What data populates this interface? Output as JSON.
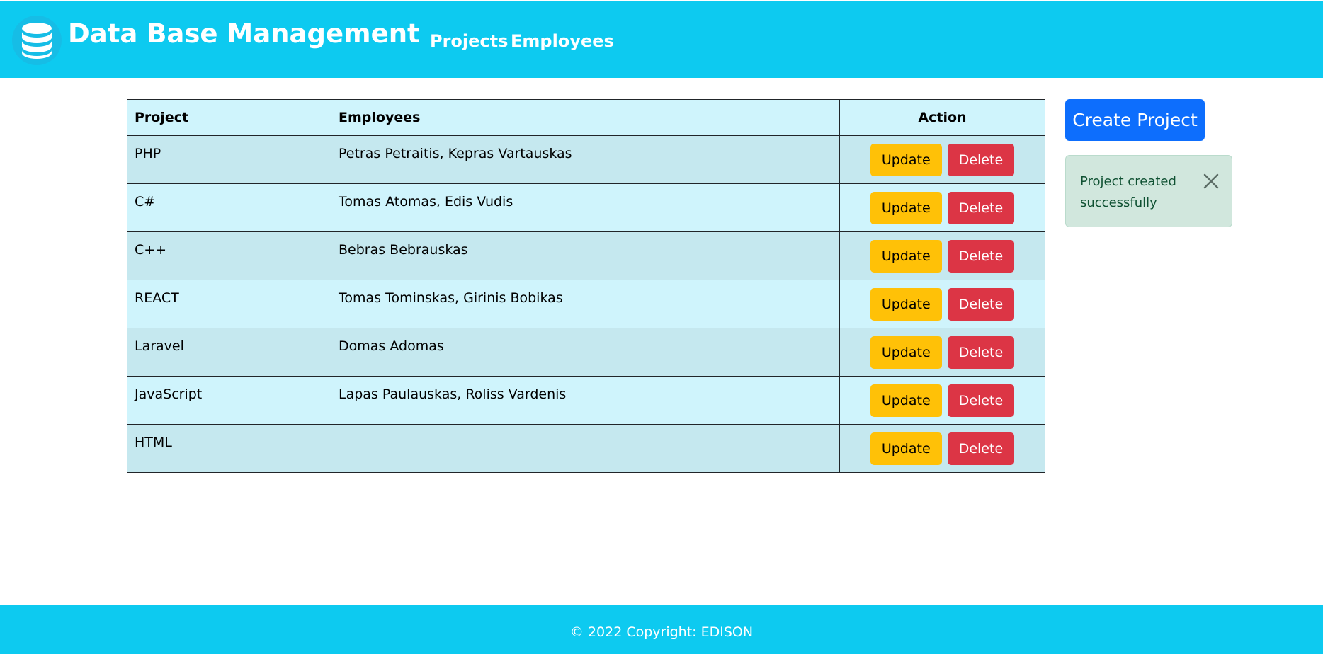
{
  "header": {
    "brand": "Data Base Management",
    "brand_icon": "database-icon",
    "nav": [
      {
        "label": "Projects"
      },
      {
        "label": "Employees"
      }
    ]
  },
  "table": {
    "headers": {
      "project": "Project",
      "employees": "Employees",
      "action": "Action"
    },
    "rows": [
      {
        "project": "PHP",
        "employees": "Petras Petraitis, Kepras Vartauskas"
      },
      {
        "project": "C#",
        "employees": "Tomas Atomas, Edis Vudis"
      },
      {
        "project": "C++",
        "employees": "Bebras Bebrauskas"
      },
      {
        "project": "REACT",
        "employees": "Tomas Tominskas, Girinis Bobikas"
      },
      {
        "project": "Laravel",
        "employees": "Domas Adomas"
      },
      {
        "project": "JavaScript",
        "employees": "Lapas Paulauskas, Roliss Vardenis"
      },
      {
        "project": "HTML",
        "employees": ""
      }
    ],
    "update_label": "Update",
    "delete_label": "Delete"
  },
  "create_button": "Create Project",
  "alert": {
    "message": "Project created successfully",
    "close_icon": "close-icon"
  },
  "footer": {
    "text": "© 2022 Copyright: EDISON"
  },
  "colors": {
    "header_bg": "#0dcaf0",
    "table_row_a": "#c5e8ef",
    "table_row_b": "#cff4fc",
    "update_btn": "#ffc107",
    "delete_btn": "#dc3545",
    "primary_btn": "#0d6efd",
    "alert_bg": "#d1e7dd"
  }
}
